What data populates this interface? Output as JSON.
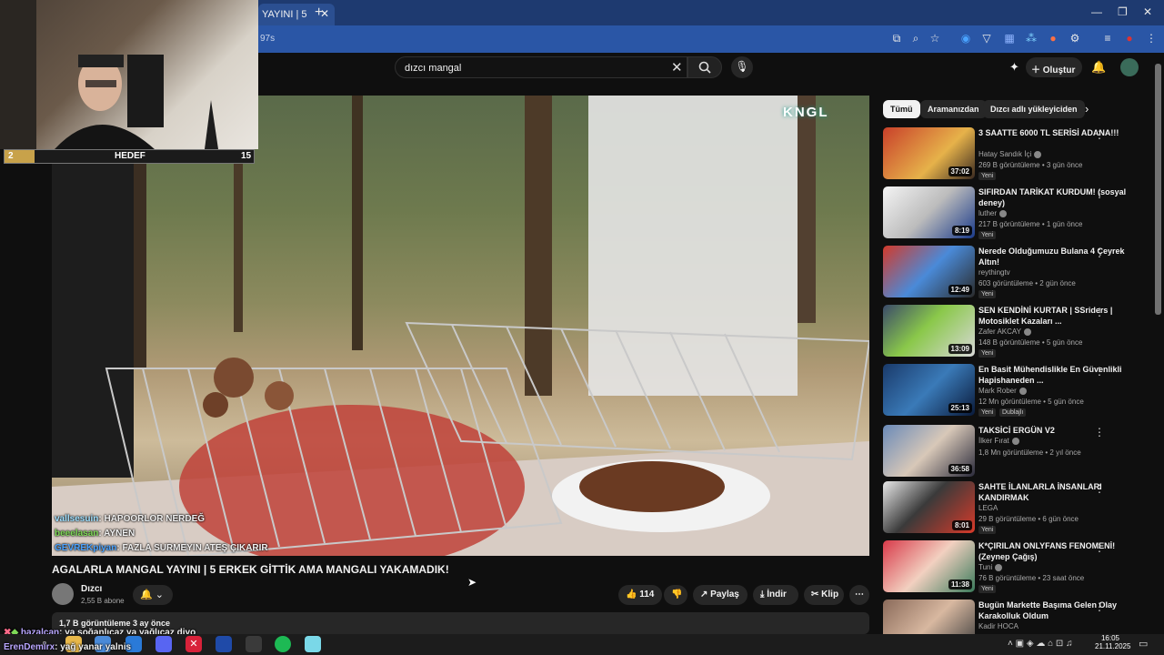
{
  "browser": {
    "tab_title": "YAYINI | 5",
    "url_fragment": "97s"
  },
  "youtube": {
    "search_query": "dızcı mangal",
    "create_label": "Oluştur"
  },
  "overlay": {
    "goal_current": "2",
    "goal_label": "HEDEF",
    "goal_target": "15",
    "watermark": "KNGL",
    "chat": [
      {
        "user": "vallsesuin",
        "msg": ": HAPOORLOR NERDEĞ"
      },
      {
        "user": "beeelasan",
        "msg": ": AYNEN"
      },
      {
        "user": "GEVREKpiyan",
        "msg": ": FAZLA SURMEYIN ATEŞ ÇIKARIR"
      }
    ],
    "bottom_chat": [
      {
        "user": "hazalcan",
        "msg": ": ya soğanlıcaz ya yağlıcaz diyo"
      },
      {
        "user": "ErenDemirx",
        "msg": ": yağ yanar yalnis"
      }
    ]
  },
  "video": {
    "title": "AGALARLA MANGAL YAYINI | 5 ERKEK GİTTİK AMA MANGALI YAKAMADIK!",
    "channel": "Dızcı",
    "subscribers": "2,55 B abone",
    "likes": "114",
    "share_label": "Paylaş",
    "download_label": "İndir",
    "clip_label": "Klip",
    "views_date": "1,7 B görüntüleme  3 ay önce"
  },
  "chips": [
    "Tümü",
    "Aramanızdan",
    "Dızcı adlı yükleyiciden"
  ],
  "recommendations": [
    {
      "title": "3 SAATTE 6000 TL SERİSİ ADANA!!!",
      "channel": "Hatay Sandık İçi",
      "meta": "269 B görüntüleme • 3 gün önce",
      "badge": "Yeni",
      "duration": "37:02",
      "verified": true
    },
    {
      "title": "SIFIRDAN TARİKAT KURDUM! (sosyal deney)",
      "channel": "luther",
      "meta": "217 B görüntüleme • 1 gün önce",
      "badge": "Yeni",
      "duration": "8:19",
      "verified": true
    },
    {
      "title": "Nerede Olduğumuzu Bulana 4 Çeyrek Altın!",
      "channel": "reythingtv",
      "meta": "603 görüntüleme • 2 gün önce",
      "badge": "Yeni",
      "duration": "12:49",
      "verified": false
    },
    {
      "title": "SEN KENDİNİ KURTAR | SSriders | Motosiklet Kazaları ...",
      "channel": "Zafer AKCAY",
      "meta": "148 B görüntüleme • 5 gün önce",
      "badge": "Yeni",
      "duration": "13:09",
      "verified": true
    },
    {
      "title": "En Basit Mühendislikle En Güvenlikli Hapishaneden ...",
      "channel": "Mark Rober",
      "meta": "12 Mn görüntüleme • 5 gün önce",
      "badge": "Yeni",
      "badge2": "Dublajlı",
      "duration": "25:13",
      "verified": true
    },
    {
      "title": "TAKSİCİ ERGÜN V2",
      "channel": "İlker Fırat",
      "meta": "1,8 Mn görüntüleme • 2 yıl önce",
      "duration": "36:58",
      "verified": true
    },
    {
      "title": "SAHTE İLANLARLA İNSANLARI KANDIRMAK",
      "channel": "LEGA",
      "meta": "29 B görüntüleme • 6 gün önce",
      "badge": "Yeni",
      "duration": "8:01",
      "verified": false
    },
    {
      "title": "K*ÇIRILAN ONLYFANS FENOMENİ! (Zeynep Çağış)",
      "channel": "Tuni",
      "meta": "76 B görüntüleme • 23 saat önce",
      "badge": "Yeni",
      "duration": "11:38",
      "verified": true
    },
    {
      "title": "Bugün Markette Başıma Gelen Olay Karakolluk Oldum",
      "channel": "Kadir HOCA",
      "meta": "",
      "duration": "",
      "verified": false
    }
  ],
  "taskbar": {
    "time": "16:05",
    "date": "21.11.2025"
  },
  "colors": {
    "accent": "#1e3a70",
    "yt_bg": "#0f0f0f",
    "goal_fill": "#c8a24a"
  }
}
